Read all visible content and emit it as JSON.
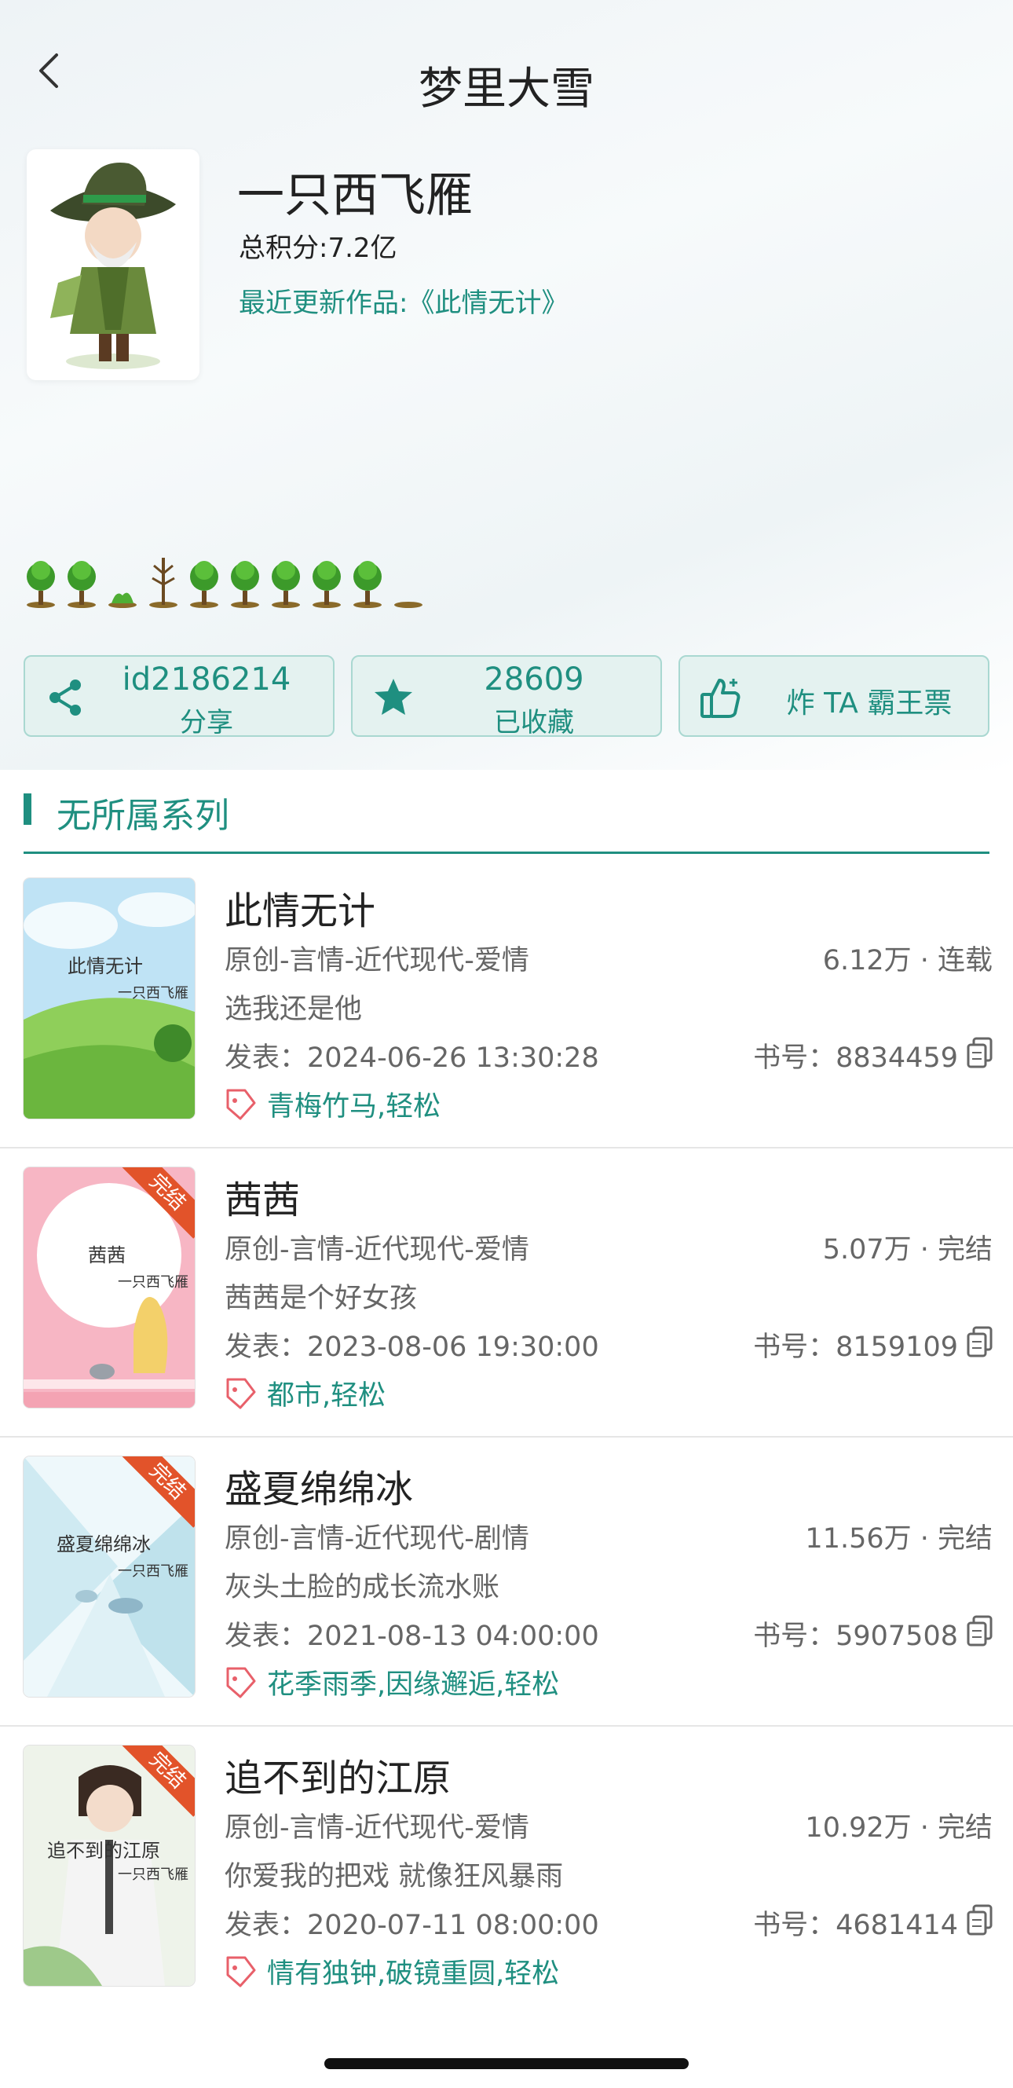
{
  "header": {
    "title": "梦里大雪",
    "back_icon": "chevron-left-icon"
  },
  "author": {
    "name": "一只西飞雁",
    "score": "总积分:7.2亿",
    "recent": "最近更新作品:《此情无计》"
  },
  "stats": {
    "share": {
      "value": "id2186214",
      "label": "分享",
      "icon": "share-icon"
    },
    "favorite": {
      "value": "28609",
      "label": "已收藏",
      "icon": "star-icon"
    },
    "vote": {
      "label": "炸 TA 霸王票",
      "icon": "thumbs-up-icon"
    }
  },
  "section": {
    "title": "无所属系列"
  },
  "books": [
    {
      "title": "此情无计",
      "genre": "原创-言情-近代现代-爱情",
      "stat": "6.12万 · 连载",
      "desc": "选我还是他",
      "published": "发表：2024-06-26 13:30:28",
      "book_no": "书号：8834459",
      "tags": "青梅竹马,轻松",
      "cover_title": "此情无计",
      "cover_author": "一只西飞雁",
      "ribbon": ""
    },
    {
      "title": "茜茜",
      "genre": "原创-言情-近代现代-爱情",
      "stat": "5.07万 · 完结",
      "desc": "茜茜是个好女孩",
      "published": "发表：2023-08-06 19:30:00",
      "book_no": "书号：8159109",
      "tags": "都市,轻松",
      "cover_title": "茜茜",
      "cover_author": "一只西飞雁",
      "ribbon": "完结"
    },
    {
      "title": "盛夏绵绵冰",
      "genre": "原创-言情-近代现代-剧情",
      "stat": "11.56万 · 完结",
      "desc": "灰头土脸的成长流水账",
      "published": "发表：2021-08-13 04:00:00",
      "book_no": "书号：5907508",
      "tags": "花季雨季,因缘邂逅,轻松",
      "cover_title": "盛夏绵绵冰",
      "cover_author": "一只西飞雁",
      "ribbon": "完结"
    },
    {
      "title": "追不到的江原",
      "genre": "原创-言情-近代现代-爱情",
      "stat": "10.92万 · 完结",
      "desc": "你爱我的把戏 就像狂风暴雨",
      "published": "发表：2020-07-11 08:00:00",
      "book_no": "书号：4681414",
      "tags": "情有独钟,破镜重圆,轻松",
      "cover_title": "追不到的江原",
      "cover_author": "一只西飞雁",
      "ribbon": "完结"
    }
  ],
  "colors": {
    "accent": "#1f8f80",
    "button_bg": "#e4f2f0",
    "button_border": "#a9d8d1",
    "ribbon": "#e2532a",
    "tag_icon": "#e8606a"
  }
}
